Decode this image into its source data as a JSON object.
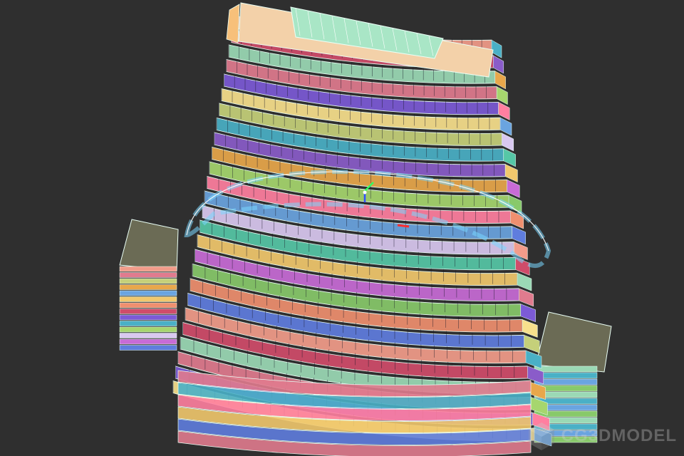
{
  "viewport": {
    "name": "3d-viewport",
    "background": "#2f2f2f"
  },
  "model": {
    "floor_count": 25,
    "band_colors": [
      "#f29c8a",
      "#d04c6a",
      "#9bd9b5",
      "#e07b8e",
      "#7c5ad6",
      "#f7e08c",
      "#c5d07a",
      "#4ab0c6",
      "#8a5cc9",
      "#e8a74b",
      "#a6d66e",
      "#ff7fa0",
      "#6aa4e0",
      "#d9c8f0",
      "#56c7a6",
      "#f1c86d",
      "#c86bd6",
      "#88c96a",
      "#ef8f6f",
      "#5f7dde"
    ],
    "wire_color": "#eafff6",
    "selection_color": "#7ad7ff"
  },
  "gizmo": {
    "x_color": "#ff3030",
    "y_color": "#30ff60",
    "z_color": "#3050ff"
  },
  "watermark": {
    "text": "CG3DMODEL",
    "icon": "cube-icon"
  }
}
